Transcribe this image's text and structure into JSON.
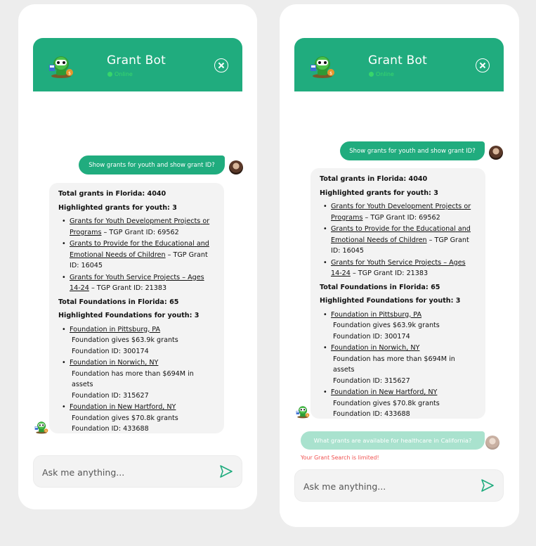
{
  "header": {
    "bot_name": "Grant Bot",
    "status": "Online"
  },
  "colors": {
    "brand": "#20ac7e",
    "online": "#37d66b",
    "warning": "#f0504f",
    "pending": "#a9e2ce"
  },
  "icons": {
    "close": "close-circle-icon",
    "send": "send-arrow-icon",
    "bot": "robot-mascot-icon"
  },
  "conversation": {
    "user_message": "Show grants for youth and show grant ID?",
    "bot_response": {
      "total_grants": "Total grants in Florida: 4040",
      "highlighted_grants_heading": "Highlighted grants for youth: 3",
      "grants": [
        {
          "title_line1": "Grants for Youth Development Projects",
          "title_line2": "or Programs",
          "suffix": " – TGP Grant ID: 69562"
        },
        {
          "title_line1": "Grants to Provide for the Educational",
          "title_line2": "and Emotional Needs of Children",
          "suffix": " – TGP Grant ID: 16045"
        },
        {
          "title_line1": "Grants for Youth Service Projects –",
          "title_line2": "Ages 14-24",
          "suffix": " – TGP Grant ID: 21383"
        }
      ],
      "total_foundations": "Total Foundations in Florida: 65",
      "highlighted_foundations_heading": "Highlighted Foundations for youth: 3",
      "foundations": [
        {
          "name": "Foundation in Pittsburg, PA",
          "detail": "Foundation gives $63.9k grants",
          "id": "Foundation ID: 300174"
        },
        {
          "name": "Foundation in Norwich, NY",
          "detail": "Foundation has more than $694M in assets",
          "id": "Foundation ID: 315627"
        },
        {
          "name": "Foundation in New Hartford, NY",
          "detail": "Foundation gives $70.8k grants",
          "id": "Foundation ID: 433688"
        }
      ]
    },
    "pending_message": "What grants are available for healthcare in California?",
    "limit_notice": "Your Grant Search is limited!"
  },
  "input": {
    "placeholder": "Ask me anything..."
  }
}
